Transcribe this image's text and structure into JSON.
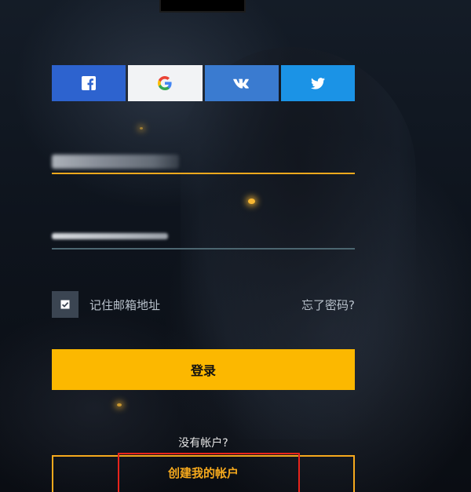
{
  "social": {
    "facebook_icon": "facebook-icon",
    "google_icon": "google-icon",
    "vk_icon": "vk-icon",
    "twitter_icon": "twitter-icon",
    "colors": {
      "facebook": "#2d63cf",
      "google": "#f2f3f5",
      "vk": "#3a7bd0",
      "twitter": "#1b93e6"
    }
  },
  "form": {
    "email_value": "",
    "password_value": "",
    "remember_label": "记住邮箱地址",
    "remember_checked": true,
    "forgot_label": "忘了密码?",
    "login_label": "登录",
    "no_account_label": "没有帐户?",
    "create_label": "创建我的帐户"
  },
  "colors": {
    "accent": "#fcb800",
    "highlight": "#e8241c"
  }
}
